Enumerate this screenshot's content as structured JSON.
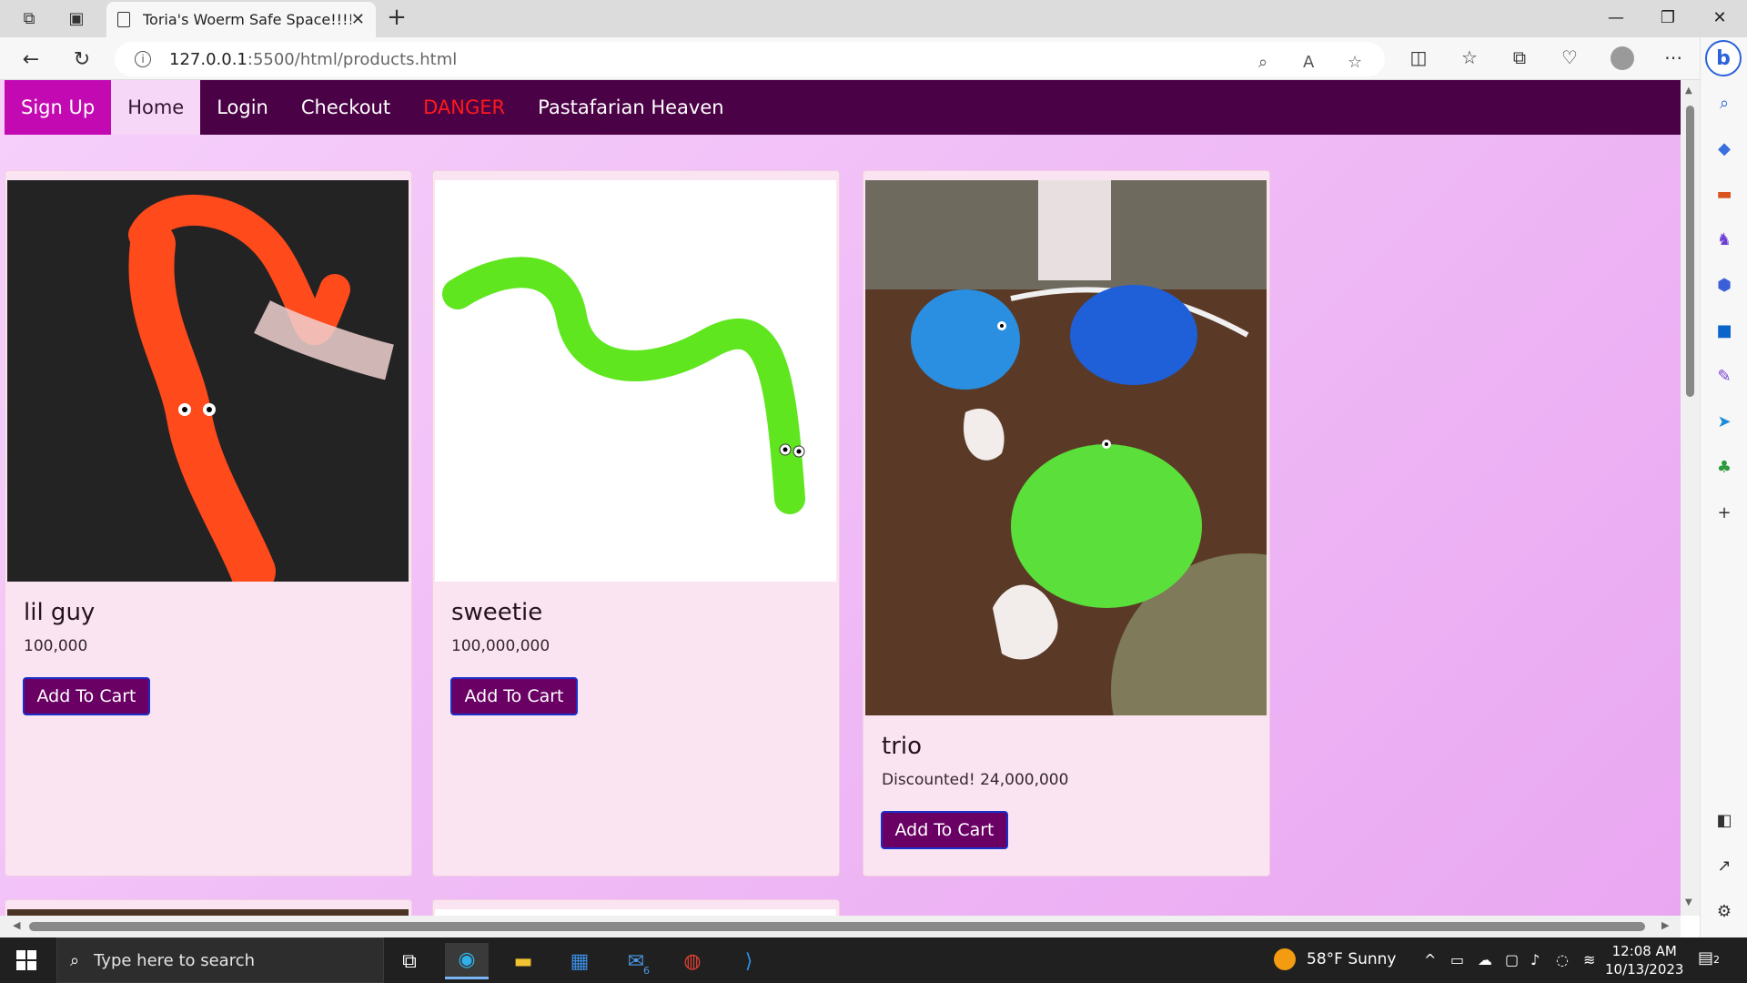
{
  "browser": {
    "tab_title": "Toria's Woerm Safe Space!!!!!! :D",
    "url_host": "127.0.0.1",
    "url_rest": ":5500/html/products.html"
  },
  "site_nav": {
    "items": [
      {
        "label": "Sign Up"
      },
      {
        "label": "Home"
      },
      {
        "label": "Login"
      },
      {
        "label": "Checkout"
      },
      {
        "label": "DANGER"
      },
      {
        "label": "Pastafarian Heaven"
      }
    ]
  },
  "products": [
    {
      "name": "lil guy",
      "price": "100,000",
      "button": "Add To Cart",
      "image": "orange-worm"
    },
    {
      "name": "sweetie",
      "price": "100,000,000",
      "button": "Add To Cart",
      "image": "green-worm"
    },
    {
      "name": "trio",
      "price": "Discounted! 24,000,000",
      "button": "Add To Cart",
      "image": "worm-trio"
    }
  ],
  "taskbar": {
    "search_placeholder": "Type here to search",
    "weather": "58°F  Sunny",
    "time": "12:08 AM",
    "date": "10/13/2023",
    "mail_badge": "6",
    "notif_count": "2"
  },
  "colors": {
    "nav_bg": "#4a0145",
    "signup_bg": "#c30ab2",
    "home_bg": "#f7d7f7",
    "danger": "#ff1a1a",
    "button_bg": "#6a0064",
    "button_border": "#1a2ec9",
    "page_gradient_start": "#f6d0fb",
    "page_gradient_end": "#e9a7f1"
  }
}
